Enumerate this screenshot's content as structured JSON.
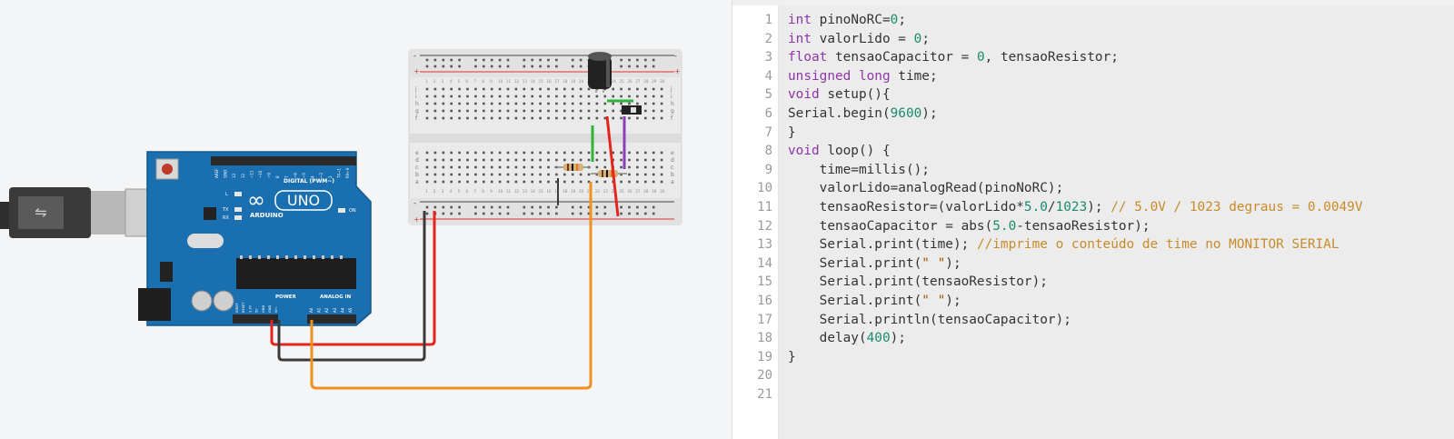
{
  "circuit": {
    "arduino": {
      "brand": "ARDUINO",
      "model": "UNO",
      "digital_label": "DIGITAL (PWM~)",
      "power_label": "POWER",
      "analog_label": "ANALOG IN",
      "on_label": "ON",
      "led_l": "L",
      "led_tx": "TX",
      "led_rx": "RX",
      "digital_pins": [
        "AREF",
        "GND",
        "13",
        "12",
        "~11",
        "~10",
        "~9",
        "8",
        "7",
        "~6",
        "~5",
        "4",
        "~3",
        "2",
        "TX→1",
        "RX←0"
      ],
      "power_pins": [
        "IOREF",
        "RESET",
        "3.3V",
        "5V",
        "GND",
        "GND",
        "Vin"
      ],
      "analog_pins": [
        "A0",
        "A1",
        "A2",
        "A3",
        "A4",
        "A5"
      ]
    },
    "breadboard": {
      "row_labels_top": [
        "j",
        "i",
        "h",
        "g",
        "f"
      ],
      "row_labels_bottom": [
        "e",
        "d",
        "c",
        "b",
        "a"
      ],
      "rail_plus": "+",
      "rail_minus": "-",
      "columns": 30
    },
    "wire_colors": {
      "red": "#e3261c",
      "black": "#3b3b3b",
      "orange": "#f0901e",
      "green": "#2fb43b",
      "purple": "#8a3fb8"
    }
  },
  "code": {
    "lines": [
      [
        [
          "kw",
          "int"
        ],
        [
          "t",
          " pinoNoRC="
        ],
        [
          "num",
          "0"
        ],
        [
          "t",
          ";"
        ]
      ],
      [
        [
          "kw",
          "int"
        ],
        [
          "t",
          " valorLido = "
        ],
        [
          "num",
          "0"
        ],
        [
          "t",
          ";"
        ]
      ],
      [
        [
          "kw",
          "float"
        ],
        [
          "t",
          " tensaoCapacitor = "
        ],
        [
          "num",
          "0"
        ],
        [
          "t",
          ", tensaoResistor;"
        ]
      ],
      [
        [
          "kw",
          "unsigned long"
        ],
        [
          "t",
          " time;"
        ]
      ],
      [
        [
          "kw",
          "void"
        ],
        [
          "t",
          " setup(){"
        ]
      ],
      [
        [
          "t",
          "Serial.begin("
        ],
        [
          "num",
          "9600"
        ],
        [
          "t",
          ");"
        ]
      ],
      [
        [
          "t",
          "}"
        ]
      ],
      [
        [
          "kw",
          "void"
        ],
        [
          "t",
          " loop() {"
        ]
      ],
      [
        [
          "t",
          "    time=millis();"
        ]
      ],
      [
        [
          "t",
          "    valorLido=analogRead(pinoNoRC);"
        ]
      ],
      [
        [
          "t",
          "    tensaoResistor=(valorLido*"
        ],
        [
          "num",
          "5.0"
        ],
        [
          "t",
          "/"
        ],
        [
          "num",
          "1023"
        ],
        [
          "t",
          "); "
        ],
        [
          "cm",
          "// 5.0V / 1023 degraus = 0.0049V"
        ]
      ],
      [
        [
          "t",
          "    tensaoCapacitor = abs("
        ],
        [
          "num",
          "5.0"
        ],
        [
          "t",
          "-tensaoResistor);"
        ]
      ],
      [
        [
          "t",
          "    Serial.print(time); "
        ],
        [
          "cm",
          "//imprime o conteúdo de time no MONITOR SERIAL"
        ]
      ],
      [
        [
          "t",
          "    Serial.print("
        ],
        [
          "str",
          "\" \""
        ],
        [
          "t",
          ");"
        ]
      ],
      [
        [
          "t",
          "    Serial.print(tensaoResistor);"
        ]
      ],
      [
        [
          "t",
          "    Serial.print("
        ],
        [
          "str",
          "\" \""
        ],
        [
          "t",
          ");"
        ]
      ],
      [
        [
          "t",
          "    Serial.println(tensaoCapacitor);"
        ]
      ],
      [
        [
          "t",
          "    delay("
        ],
        [
          "num",
          "400"
        ],
        [
          "t",
          ");"
        ]
      ],
      [
        [
          "t",
          "}"
        ]
      ],
      [
        [
          "t",
          ""
        ]
      ],
      [
        [
          "t",
          ""
        ]
      ]
    ]
  }
}
